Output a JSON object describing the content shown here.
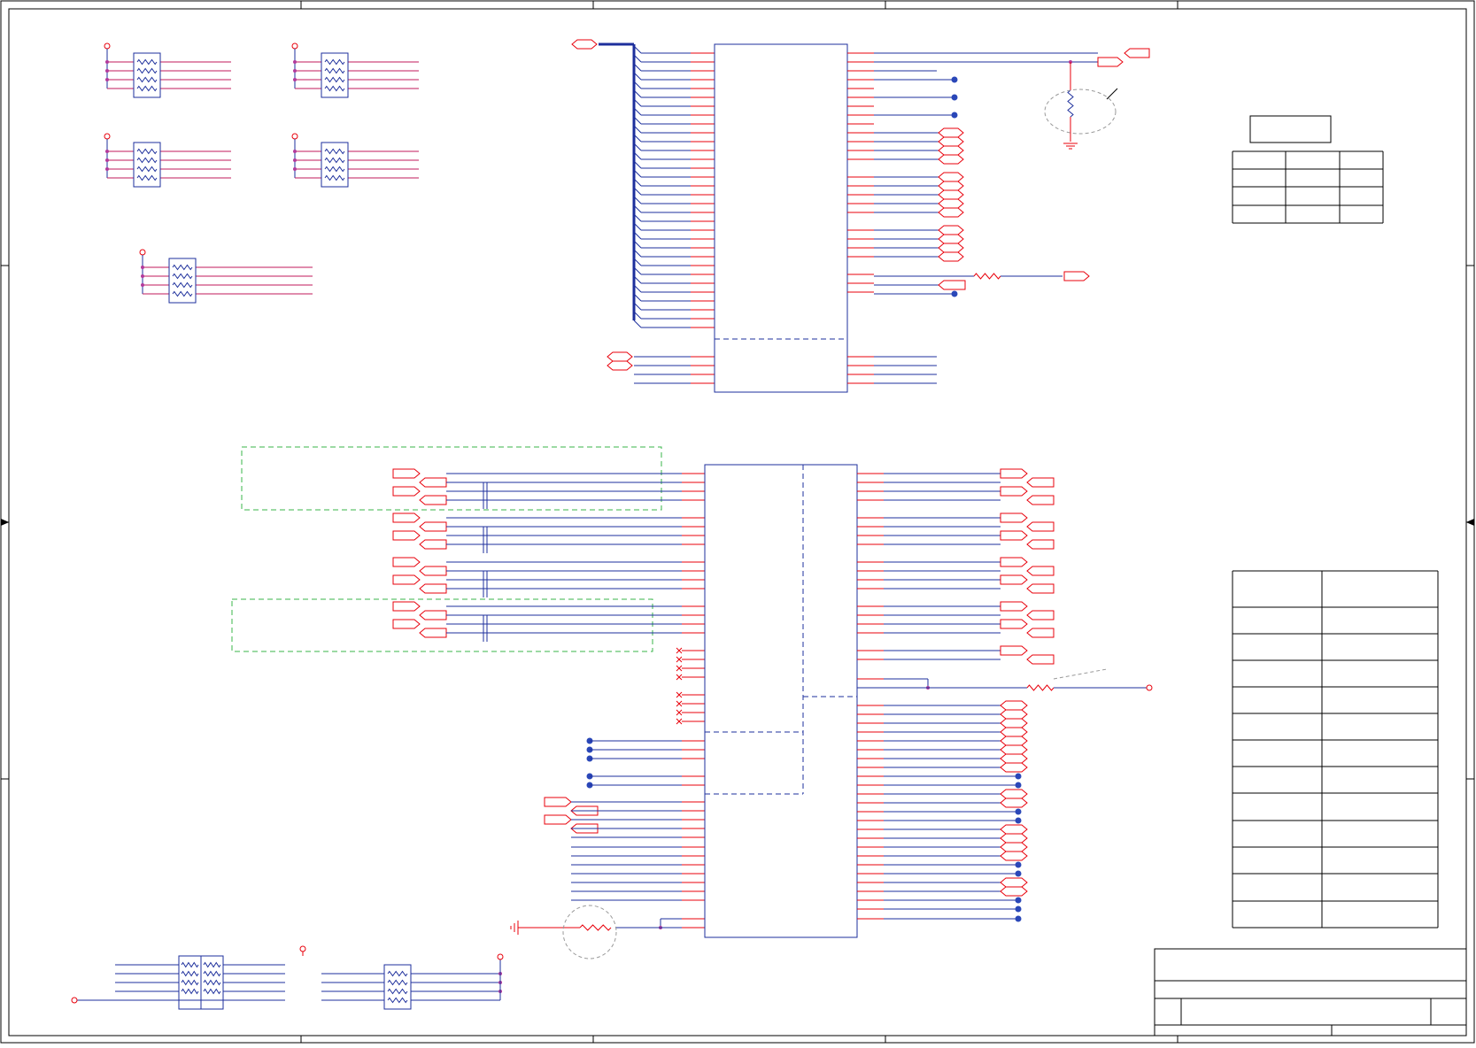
{
  "sheet": {
    "type": "electronic schematic",
    "colors": {
      "net_wire": "#e8000b",
      "bus_and_component": "#1d2f9c",
      "pin_stub": "#c2185b",
      "junction": "#b23a9c",
      "no_connect_dot": "#2a47b8",
      "highlight_box": "#39b54a",
      "paper": "#ffffff",
      "frame": "#000000"
    }
  },
  "icons": {
    "resistor_network": "resistor-network-icon",
    "resistor": "resistor-icon",
    "capacitor": "capacitor-icon",
    "ground": "ground-symbol-icon",
    "power_flag": "power-flag-icon",
    "offpage_connector": "offpage-connector-icon",
    "no_connect": "no-connect-dot-icon"
  }
}
